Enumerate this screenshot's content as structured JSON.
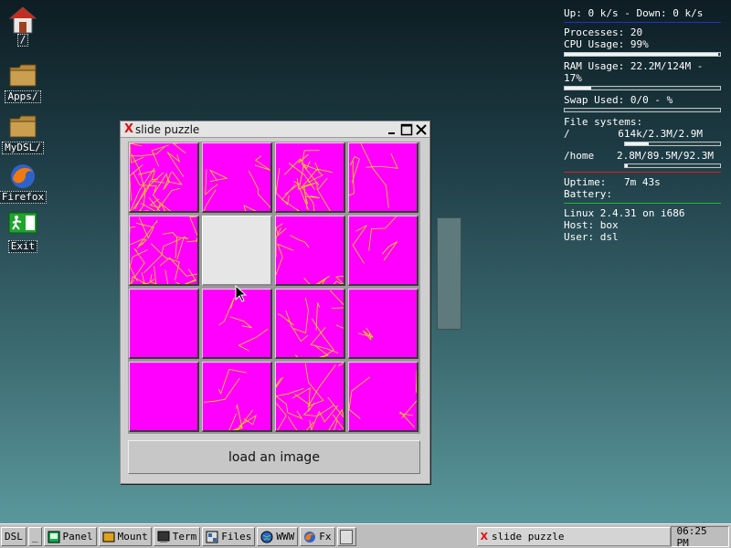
{
  "desktop_icons": [
    {
      "label": "/",
      "icon": "home-icon"
    },
    {
      "label": "Apps/",
      "icon": "folder-icon"
    },
    {
      "label": "MyDSL/",
      "icon": "folder-icon"
    },
    {
      "label": "Firefox",
      "icon": "firefox-icon"
    },
    {
      "label": "Exit",
      "icon": "exit-icon"
    }
  ],
  "monitor": {
    "net": "Up: 0 k/s - Down: 0 k/s",
    "processes": "Processes: 20",
    "cpu": "CPU Usage: 99%",
    "cpu_pct": 0.99,
    "ram": "RAM Usage: 22.2M/124M - 17%",
    "ram_pct": 0.17,
    "swap": "Swap Used: 0/0 - %",
    "swap_pct": 0,
    "fs_header": "File systems:",
    "fs": [
      {
        "mount": "/",
        "usage": "614k/2.3M/2.9M",
        "pct": 0.25
      },
      {
        "mount": "/home",
        "usage": "2.8M/89.5M/92.3M",
        "pct": 0.03
      }
    ],
    "uptime_label": "Uptime:",
    "uptime": "7m 43s",
    "battery": "Battery:",
    "os": "Linux 2.4.31 on i686",
    "host": "Host: box",
    "user": "User: dsl",
    "colors": {
      "net_sep": "#1f2ee0",
      "fs_sep": "#e01c1c",
      "uptime_sep": "#15c020"
    }
  },
  "window": {
    "title": "slide puzzle",
    "button_label": "load an image",
    "empty_tile_index": 5
  },
  "taskbar": {
    "start": "DSL",
    "minimize": "_",
    "items": [
      {
        "label": "Panel",
        "icon": "panel-icon"
      },
      {
        "label": "Mount",
        "icon": "mount-icon"
      },
      {
        "label": "Term",
        "icon": "terminal-icon"
      },
      {
        "label": "Files",
        "icon": "files-icon"
      },
      {
        "label": "WWW",
        "icon": "globe-icon"
      },
      {
        "label": "Fx",
        "icon": "firefox-icon"
      }
    ],
    "task": "slide puzzle",
    "clock": "06:25 PM"
  }
}
